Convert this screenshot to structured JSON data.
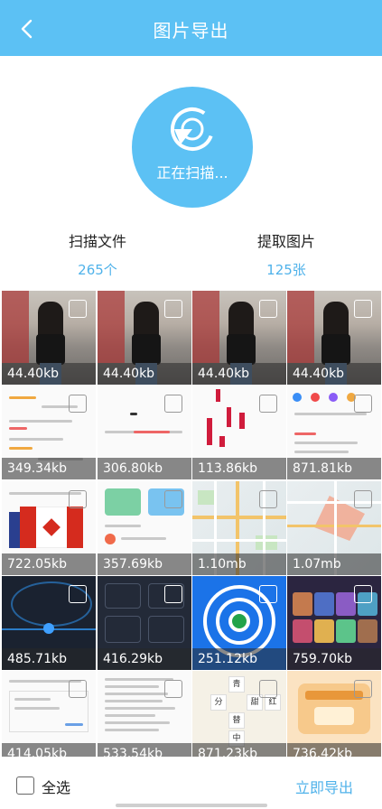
{
  "header": {
    "title": "图片导出"
  },
  "scan": {
    "status": "正在扫描..."
  },
  "stats": {
    "files_label": "扫描文件",
    "files_value": "265个",
    "images_label": "提取图片",
    "images_value": "125张"
  },
  "thumbnails": [
    "44.40kb",
    "44.40kb",
    "44.40kb",
    "44.40kb",
    "349.34kb",
    "306.80kb",
    "113.86kb",
    "871.81kb",
    "722.05kb",
    "357.69kb",
    "1.10mb",
    "1.07mb",
    "485.71kb",
    "416.29kb",
    "251.12kb",
    "759.70kb",
    "414.05kb",
    "533.54kb",
    "871.23kb",
    "736.42kb"
  ],
  "footer": {
    "select_all": "全选",
    "export": "立即导出"
  },
  "colors": {
    "accent": "#5cc1f4",
    "link": "#4fb2ea"
  },
  "icons": {
    "back": "chevron-left-icon",
    "scan": "scan-progress-icon"
  }
}
